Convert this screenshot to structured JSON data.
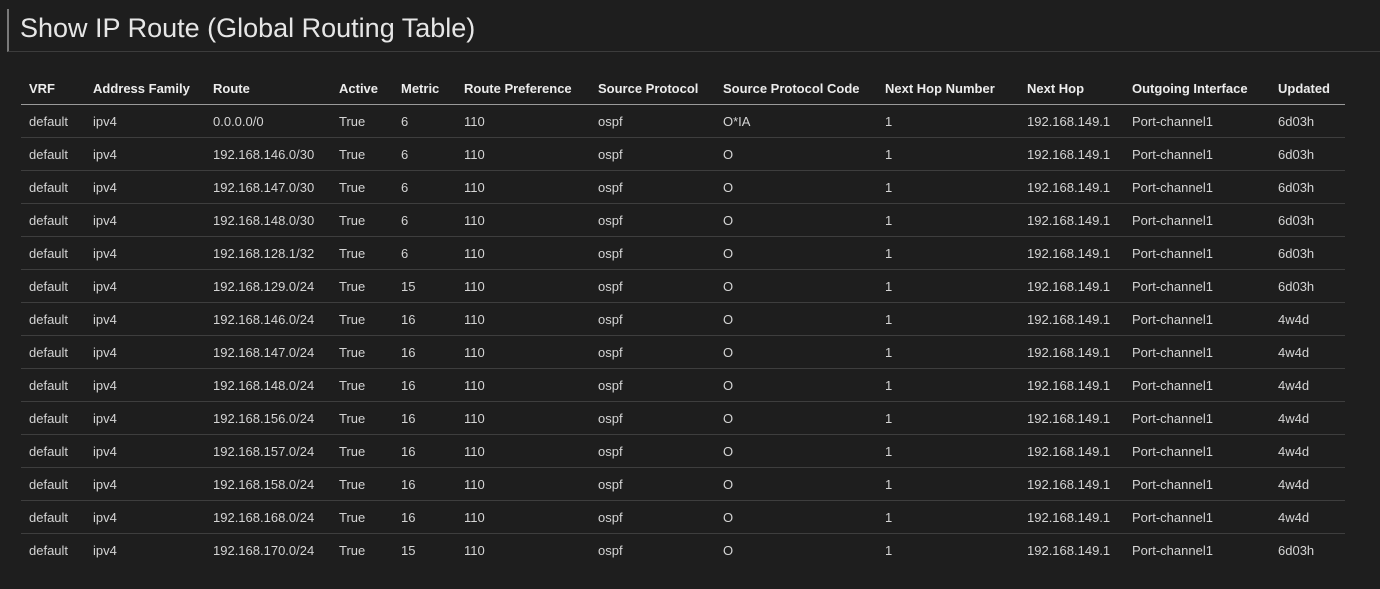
{
  "page": {
    "title": "Show IP Route (Global Routing Table)"
  },
  "table": {
    "columns": [
      "VRF",
      "Address Family",
      "Route",
      "Active",
      "Metric",
      "Route Preference",
      "Source Protocol",
      "Source Protocol Code",
      "Next Hop Number",
      "Next Hop",
      "Outgoing Interface",
      "Updated"
    ],
    "rows": [
      [
        "default",
        "ipv4",
        "0.0.0.0/0",
        "True",
        "6",
        "110",
        "ospf",
        "O*IA",
        "1",
        "192.168.149.1",
        "Port-channel1",
        "6d03h"
      ],
      [
        "default",
        "ipv4",
        "192.168.146.0/30",
        "True",
        "6",
        "110",
        "ospf",
        "O",
        "1",
        "192.168.149.1",
        "Port-channel1",
        "6d03h"
      ],
      [
        "default",
        "ipv4",
        "192.168.147.0/30",
        "True",
        "6",
        "110",
        "ospf",
        "O",
        "1",
        "192.168.149.1",
        "Port-channel1",
        "6d03h"
      ],
      [
        "default",
        "ipv4",
        "192.168.148.0/30",
        "True",
        "6",
        "110",
        "ospf",
        "O",
        "1",
        "192.168.149.1",
        "Port-channel1",
        "6d03h"
      ],
      [
        "default",
        "ipv4",
        "192.168.128.1/32",
        "True",
        "6",
        "110",
        "ospf",
        "O",
        "1",
        "192.168.149.1",
        "Port-channel1",
        "6d03h"
      ],
      [
        "default",
        "ipv4",
        "192.168.129.0/24",
        "True",
        "15",
        "110",
        "ospf",
        "O",
        "1",
        "192.168.149.1",
        "Port-channel1",
        "6d03h"
      ],
      [
        "default",
        "ipv4",
        "192.168.146.0/24",
        "True",
        "16",
        "110",
        "ospf",
        "O",
        "1",
        "192.168.149.1",
        "Port-channel1",
        "4w4d"
      ],
      [
        "default",
        "ipv4",
        "192.168.147.0/24",
        "True",
        "16",
        "110",
        "ospf",
        "O",
        "1",
        "192.168.149.1",
        "Port-channel1",
        "4w4d"
      ],
      [
        "default",
        "ipv4",
        "192.168.148.0/24",
        "True",
        "16",
        "110",
        "ospf",
        "O",
        "1",
        "192.168.149.1",
        "Port-channel1",
        "4w4d"
      ],
      [
        "default",
        "ipv4",
        "192.168.156.0/24",
        "True",
        "16",
        "110",
        "ospf",
        "O",
        "1",
        "192.168.149.1",
        "Port-channel1",
        "4w4d"
      ],
      [
        "default",
        "ipv4",
        "192.168.157.0/24",
        "True",
        "16",
        "110",
        "ospf",
        "O",
        "1",
        "192.168.149.1",
        "Port-channel1",
        "4w4d"
      ],
      [
        "default",
        "ipv4",
        "192.168.158.0/24",
        "True",
        "16",
        "110",
        "ospf",
        "O",
        "1",
        "192.168.149.1",
        "Port-channel1",
        "4w4d"
      ],
      [
        "default",
        "ipv4",
        "192.168.168.0/24",
        "True",
        "16",
        "110",
        "ospf",
        "O",
        "1",
        "192.168.149.1",
        "Port-channel1",
        "4w4d"
      ],
      [
        "default",
        "ipv4",
        "192.168.170.0/24",
        "True",
        "15",
        "110",
        "ospf",
        "O",
        "1",
        "192.168.149.1",
        "Port-channel1",
        "6d03h"
      ]
    ]
  }
}
